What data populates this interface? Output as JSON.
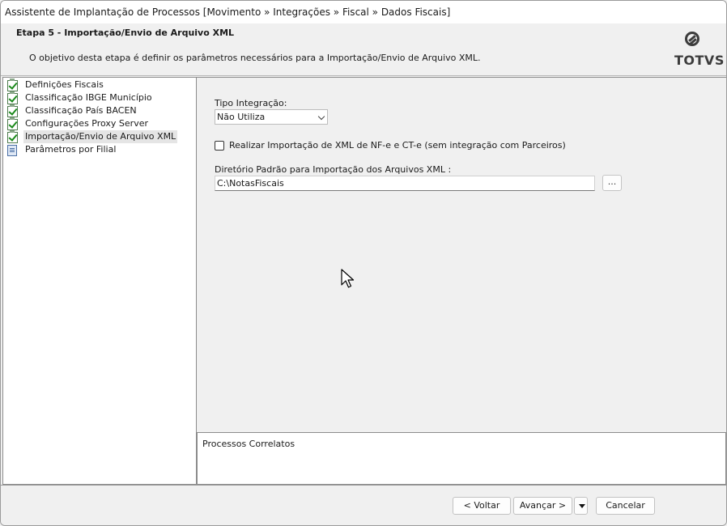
{
  "window": {
    "title": "Assistente de Implantação de Processos [Movimento » Integrações » Fiscal » Dados Fiscais]"
  },
  "header": {
    "step_title": "Etapa 5 - Importação/Envio de Arquivo XML",
    "description": "O objetivo desta etapa é definir os parâmetros necessários para a Importação/Envio de Arquivo XML.",
    "logo_text": "TOTVS"
  },
  "tree": {
    "items": [
      {
        "label": "Definições Fiscais",
        "icon": "check-document-icon"
      },
      {
        "label": "Classificação IBGE Município",
        "icon": "check-document-icon"
      },
      {
        "label": "Classificação País BACEN",
        "icon": "check-document-icon"
      },
      {
        "label": "Configurações Proxy Server",
        "icon": "check-document-icon"
      },
      {
        "label": "Importação/Envio de Arquivo XML",
        "icon": "check-document-icon",
        "selected": true
      },
      {
        "label": "Parâmetros por Filial",
        "icon": "document-list-icon"
      }
    ]
  },
  "form": {
    "tipo_label": "Tipo Integração:",
    "tipo_value": "Não Utiliza",
    "checkbox_label": "Realizar Importação de XML de NF-e e CT-e (sem integração com Parceiros)",
    "checkbox_checked": false,
    "dir_label": "Diretório Padrão para Importação dos Arquivos XML :",
    "dir_value": "C:\\NotasFiscais",
    "browse_label": "..."
  },
  "related": {
    "title": "Processos Correlatos"
  },
  "footer": {
    "back_label": "< Voltar",
    "next_label": "Avançar >",
    "cancel_label": "Cancelar"
  }
}
